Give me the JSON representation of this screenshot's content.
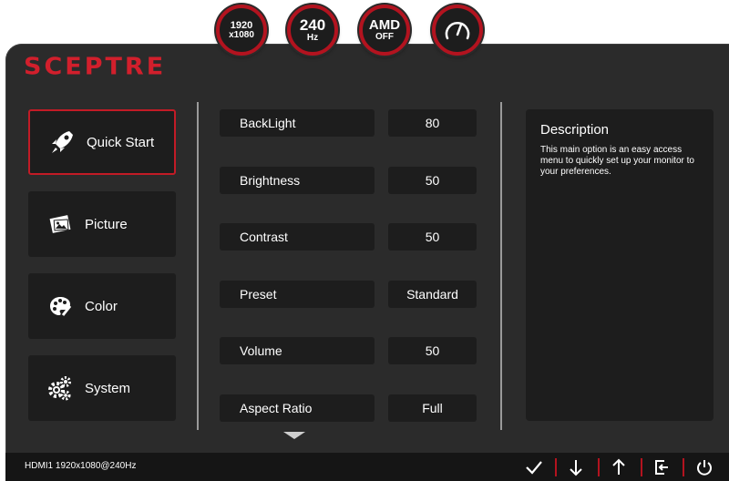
{
  "badges": {
    "resolution": {
      "line1": "1920",
      "line2": "x1080"
    },
    "refresh": {
      "value": "240",
      "unit": "Hz"
    },
    "amd": {
      "label": "AMD",
      "state": "OFF"
    },
    "gauge": {
      "icon": "speedometer-icon"
    }
  },
  "brand": {
    "logo": "SCEPTRE",
    "color": "#d21f2c"
  },
  "menu": {
    "items": [
      {
        "label": "Quick Start",
        "icon": "rocket-icon",
        "active": true
      },
      {
        "label": "Picture",
        "icon": "picture-icon",
        "active": false
      },
      {
        "label": "Color",
        "icon": "palette-icon",
        "active": false
      },
      {
        "label": "System",
        "icon": "gears-icon",
        "active": false
      }
    ]
  },
  "settings": [
    {
      "label": "BackLight",
      "value": "80"
    },
    {
      "label": "Brightness",
      "value": "50"
    },
    {
      "label": "Contrast",
      "value": "50"
    },
    {
      "label": "Preset",
      "value": "Standard"
    },
    {
      "label": "Volume",
      "value": "50"
    },
    {
      "label": "Aspect Ratio",
      "value": "Full"
    }
  ],
  "description": {
    "title": "Description",
    "text": "This main option is an easy access menu to quickly set up your monitor to your preferences."
  },
  "statusbar": {
    "input": "HDMI1 1920x1080@240Hz",
    "buttons": [
      "check-icon",
      "arrow-down-icon",
      "arrow-up-icon",
      "exit-icon",
      "power-icon"
    ]
  },
  "colors": {
    "accent": "#b3131f",
    "panel": "#2b2b2b",
    "tile": "#1d1d1d"
  }
}
